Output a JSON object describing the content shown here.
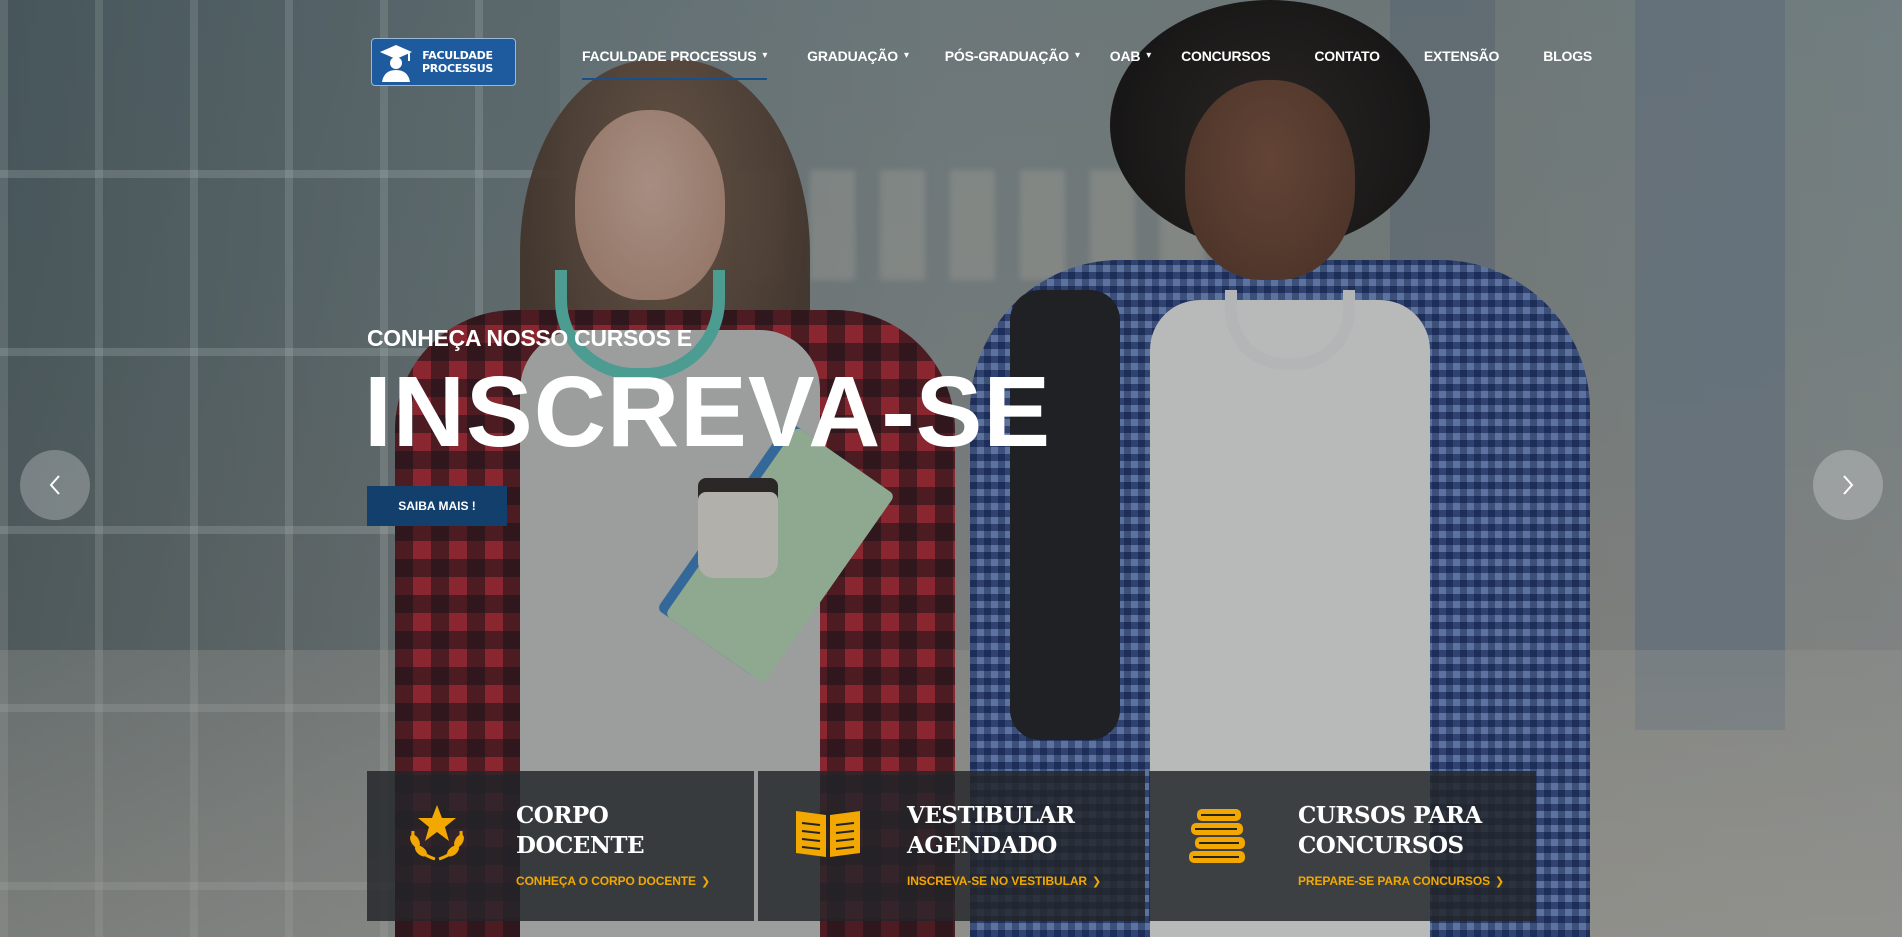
{
  "brand": {
    "logo_line1": "FACULDADE",
    "logo_line2": "PROCESSUS",
    "primary_color": "#123f6c",
    "accent_color": "#f2a800"
  },
  "nav": {
    "items": [
      {
        "label": "FACULDADE PROCESSUS",
        "has_dropdown": true,
        "active": true
      },
      {
        "label": "GRADUAÇÃO",
        "has_dropdown": true,
        "active": false
      },
      {
        "label": "PÓS-GRADUAÇÃO",
        "has_dropdown": true,
        "active": false
      },
      {
        "label": "OAB",
        "has_dropdown": true,
        "active": false
      },
      {
        "label": "CONCURSOS",
        "has_dropdown": false,
        "active": false
      },
      {
        "label": "CONTATO",
        "has_dropdown": false,
        "active": false
      },
      {
        "label": "EXTENSÃO",
        "has_dropdown": false,
        "active": false
      },
      {
        "label": "BLOGS",
        "has_dropdown": false,
        "active": false
      }
    ],
    "chevron": "▾"
  },
  "hero": {
    "eyebrow": "CONHEÇA NOSSO CURSOS E",
    "headline": "INSCREVA-SE",
    "cta_label": "SAIBA MAIS !"
  },
  "carousel": {
    "prev_icon": "chevron-left-icon",
    "next_icon": "chevron-right-icon"
  },
  "cards": [
    {
      "title_line1": "CORPO",
      "title_line2": "DOCENTE",
      "link": "CONHEÇA O CORPO DOCENTE",
      "icon": "laurel-star-icon"
    },
    {
      "title_line1": "VESTIBULAR",
      "title_line2": "AGENDADO",
      "link": "INSCREVA-SE NO VESTIBULAR",
      "icon": "open-book-icon"
    },
    {
      "title_line1": "CURSOS PARA",
      "title_line2": "CONCURSOS",
      "link": "PREPARE-SE PARA CONCURSOS",
      "icon": "book-stack-icon"
    }
  ]
}
